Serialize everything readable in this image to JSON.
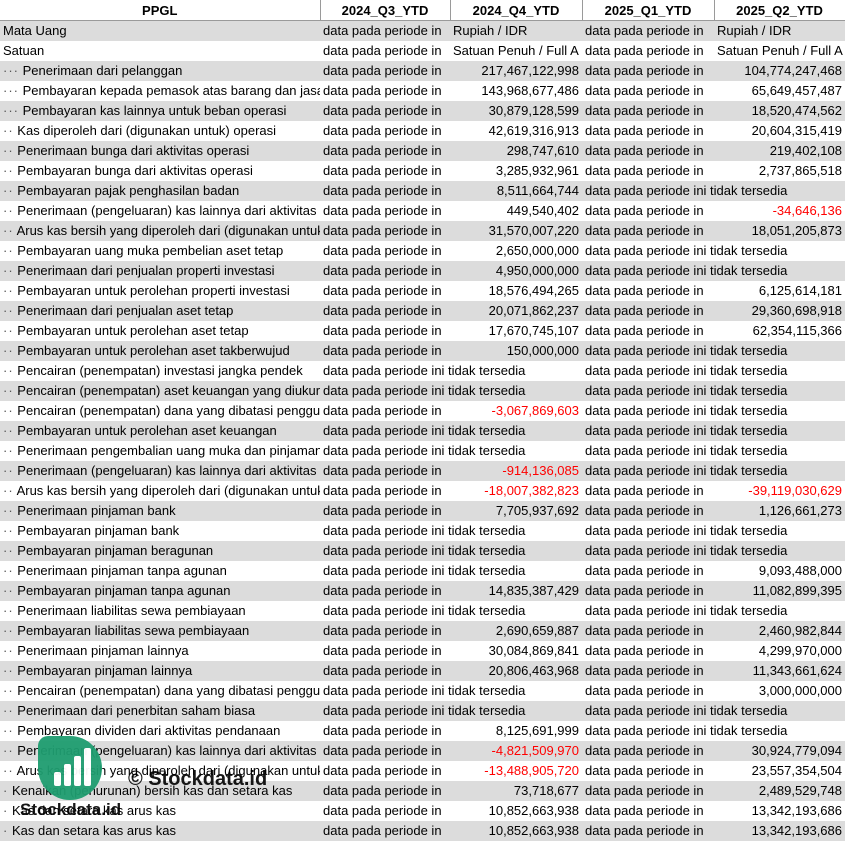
{
  "header": [
    "PPGL",
    "2024_Q3_YTD",
    "2024_Q4_YTD",
    "2025_Q1_YTD",
    "2025_Q2_YTD"
  ],
  "rows": [
    {
      "label": "Mata Uang",
      "dots": "",
      "cells": [
        {
          "v": "data pada periode in",
          "a": "l"
        },
        {
          "v": "Rupiah / IDR",
          "a": "l"
        },
        {
          "v": "data pada periode in",
          "a": "l"
        },
        {
          "v": "Rupiah / IDR",
          "a": "l"
        }
      ]
    },
    {
      "label": "Satuan",
      "dots": "",
      "cells": [
        {
          "v": "data pada periode in",
          "a": "l"
        },
        {
          "v": "Satuan Penuh / Full A",
          "a": "l"
        },
        {
          "v": "data pada periode in",
          "a": "l"
        },
        {
          "v": "Satuan Penuh / Full A",
          "a": "l"
        }
      ]
    },
    {
      "label": "Penerimaan dari pelanggan",
      "dots": "···",
      "cells": [
        {
          "v": "data pada periode in",
          "a": "l"
        },
        {
          "v": "217,467,122,998",
          "a": "r"
        },
        {
          "v": "data pada periode in",
          "a": "l"
        },
        {
          "v": "104,774,247,468",
          "a": "r"
        }
      ]
    },
    {
      "label": "Pembayaran kepada pemasok atas barang dan jasa",
      "dots": "···",
      "cells": [
        {
          "v": "data pada periode in",
          "a": "l"
        },
        {
          "v": "143,968,677,486",
          "a": "r"
        },
        {
          "v": "data pada periode in",
          "a": "l"
        },
        {
          "v": "65,649,457,487",
          "a": "r"
        }
      ]
    },
    {
      "label": "Pembayaran kas lainnya untuk beban operasi",
      "dots": "···",
      "cells": [
        {
          "v": "data pada periode in",
          "a": "l"
        },
        {
          "v": "30,879,128,599",
          "a": "r"
        },
        {
          "v": "data pada periode in",
          "a": "l"
        },
        {
          "v": "18,520,474,562",
          "a": "r"
        }
      ]
    },
    {
      "label": "Kas diperoleh dari (digunakan untuk) operasi",
      "dots": "··",
      "cells": [
        {
          "v": "data pada periode in",
          "a": "l"
        },
        {
          "v": "42,619,316,913",
          "a": "r"
        },
        {
          "v": "data pada periode in",
          "a": "l"
        },
        {
          "v": "20,604,315,419",
          "a": "r"
        }
      ]
    },
    {
      "label": "Penerimaan bunga dari aktivitas operasi",
      "dots": "··",
      "cells": [
        {
          "v": "data pada periode in",
          "a": "l"
        },
        {
          "v": "298,747,610",
          "a": "r"
        },
        {
          "v": "data pada periode in",
          "a": "l"
        },
        {
          "v": "219,402,108",
          "a": "r"
        }
      ]
    },
    {
      "label": "Pembayaran bunga dari aktivitas operasi",
      "dots": "··",
      "cells": [
        {
          "v": "data pada periode in",
          "a": "l"
        },
        {
          "v": "3,285,932,961",
          "a": "r"
        },
        {
          "v": "data pada periode in",
          "a": "l"
        },
        {
          "v": "2,737,865,518",
          "a": "r"
        }
      ]
    },
    {
      "label": "Pembayaran pajak penghasilan badan",
      "dots": "··",
      "cells": [
        {
          "v": "data pada periode in",
          "a": "l"
        },
        {
          "v": "8,511,664,744",
          "a": "r"
        },
        {
          "v": "data pada periode ini tidak tersedia",
          "a": "l",
          "span": 2
        }
      ]
    },
    {
      "label": "Penerimaan (pengeluaran) kas lainnya dari aktivitas operasi",
      "dots": "··",
      "cells": [
        {
          "v": "data pada periode in",
          "a": "l"
        },
        {
          "v": "449,540,402",
          "a": "r"
        },
        {
          "v": "data pada periode in",
          "a": "l"
        },
        {
          "v": "-34,646,136",
          "a": "r",
          "neg": true
        }
      ]
    },
    {
      "label": "Arus kas bersih yang diperoleh dari (digunakan untuk) aktivitas operasi",
      "dots": "··",
      "cells": [
        {
          "v": "data pada periode in",
          "a": "l"
        },
        {
          "v": "31,570,007,220",
          "a": "r"
        },
        {
          "v": "data pada periode in",
          "a": "l"
        },
        {
          "v": "18,051,205,873",
          "a": "r"
        }
      ]
    },
    {
      "label": "Pembayaran uang muka pembelian aset tetap",
      "dots": "··",
      "cells": [
        {
          "v": "data pada periode in",
          "a": "l"
        },
        {
          "v": "2,650,000,000",
          "a": "r"
        },
        {
          "v": "data pada periode ini tidak tersedia",
          "a": "l",
          "span": 2
        }
      ]
    },
    {
      "label": "Penerimaan dari penjualan properti investasi",
      "dots": "··",
      "cells": [
        {
          "v": "data pada periode in",
          "a": "l"
        },
        {
          "v": "4,950,000,000",
          "a": "r"
        },
        {
          "v": "data pada periode ini tidak tersedia",
          "a": "l",
          "span": 2
        }
      ]
    },
    {
      "label": "Pembayaran untuk perolehan properti investasi",
      "dots": "··",
      "cells": [
        {
          "v": "data pada periode in",
          "a": "l"
        },
        {
          "v": "18,576,494,265",
          "a": "r"
        },
        {
          "v": "data pada periode in",
          "a": "l"
        },
        {
          "v": "6,125,614,181",
          "a": "r"
        }
      ]
    },
    {
      "label": "Penerimaan dari penjualan aset tetap",
      "dots": "··",
      "cells": [
        {
          "v": "data pada periode in",
          "a": "l"
        },
        {
          "v": "20,071,862,237",
          "a": "r"
        },
        {
          "v": "data pada periode in",
          "a": "l"
        },
        {
          "v": "29,360,698,918",
          "a": "r"
        }
      ]
    },
    {
      "label": "Pembayaran untuk perolehan aset tetap",
      "dots": "··",
      "cells": [
        {
          "v": "data pada periode in",
          "a": "l"
        },
        {
          "v": "17,670,745,107",
          "a": "r"
        },
        {
          "v": "data pada periode in",
          "a": "l"
        },
        {
          "v": "62,354,115,366",
          "a": "r"
        }
      ]
    },
    {
      "label": "Pembayaran untuk perolehan aset takberwujud",
      "dots": "··",
      "cells": [
        {
          "v": "data pada periode in",
          "a": "l"
        },
        {
          "v": "150,000,000",
          "a": "r"
        },
        {
          "v": "data pada periode ini tidak tersedia",
          "a": "l",
          "span": 2
        }
      ]
    },
    {
      "label": "Pencairan (penempatan) investasi jangka pendek",
      "dots": "··",
      "cells": [
        {
          "v": "data pada periode ini tidak tersedia",
          "a": "l",
          "span": 2
        },
        {
          "v": "data pada periode ini tidak tersedia",
          "a": "l",
          "span": 2
        }
      ]
    },
    {
      "label": "Pencairan (penempatan) aset keuangan yang diukur",
      "dots": "··",
      "cells": [
        {
          "v": "data pada periode ini tidak tersedia",
          "a": "l",
          "span": 2
        },
        {
          "v": "data pada periode ini tidak tersedia",
          "a": "l",
          "span": 2
        }
      ]
    },
    {
      "label": "Pencairan (penempatan) dana yang dibatasi penggunaannya",
      "dots": "··",
      "cells": [
        {
          "v": "data pada periode in",
          "a": "l"
        },
        {
          "v": "-3,067,869,603",
          "a": "r",
          "neg": true
        },
        {
          "v": "data pada periode ini tidak tersedia",
          "a": "l",
          "span": 2
        }
      ]
    },
    {
      "label": "Pembayaran untuk perolehan aset keuangan",
      "dots": "··",
      "cells": [
        {
          "v": "data pada periode ini tidak tersedia",
          "a": "l",
          "span": 2
        },
        {
          "v": "data pada periode ini tidak tersedia",
          "a": "l",
          "span": 2
        }
      ]
    },
    {
      "label": "Penerimaan pengembalian uang muka dan pinjaman",
      "dots": "··",
      "cells": [
        {
          "v": "data pada periode ini tidak tersedia",
          "a": "l",
          "span": 2
        },
        {
          "v": "data pada periode ini tidak tersedia",
          "a": "l",
          "span": 2
        }
      ]
    },
    {
      "label": "Penerimaan (pengeluaran) kas lainnya dari aktivitas investasi",
      "dots": "··",
      "cells": [
        {
          "v": "data pada periode in",
          "a": "l"
        },
        {
          "v": "-914,136,085",
          "a": "r",
          "neg": true
        },
        {
          "v": "data pada periode ini tidak tersedia",
          "a": "l",
          "span": 2
        }
      ]
    },
    {
      "label": "Arus kas bersih yang diperoleh dari (digunakan untuk) aktivitas investasi",
      "dots": "··",
      "cells": [
        {
          "v": "data pada periode in",
          "a": "l"
        },
        {
          "v": "-18,007,382,823",
          "a": "r",
          "neg": true
        },
        {
          "v": "data pada periode in",
          "a": "l"
        },
        {
          "v": "-39,119,030,629",
          "a": "r",
          "neg": true
        }
      ]
    },
    {
      "label": "Penerimaan pinjaman bank",
      "dots": "··",
      "cells": [
        {
          "v": "data pada periode in",
          "a": "l"
        },
        {
          "v": "7,705,937,692",
          "a": "r"
        },
        {
          "v": "data pada periode in",
          "a": "l"
        },
        {
          "v": "1,126,661,273",
          "a": "r"
        }
      ]
    },
    {
      "label": "Pembayaran pinjaman bank",
      "dots": "··",
      "cells": [
        {
          "v": "data pada periode ini tidak tersedia",
          "a": "l",
          "span": 2
        },
        {
          "v": "data pada periode ini tidak tersedia",
          "a": "l",
          "span": 2
        }
      ]
    },
    {
      "label": "Pembayaran pinjaman beragunan",
      "dots": "··",
      "cells": [
        {
          "v": "data pada periode ini tidak tersedia",
          "a": "l",
          "span": 2
        },
        {
          "v": "data pada periode ini tidak tersedia",
          "a": "l",
          "span": 2
        }
      ]
    },
    {
      "label": "Penerimaan pinjaman tanpa agunan",
      "dots": "··",
      "cells": [
        {
          "v": "data pada periode ini tidak tersedia",
          "a": "l",
          "span": 2
        },
        {
          "v": "data pada periode in",
          "a": "l"
        },
        {
          "v": "9,093,488,000",
          "a": "r"
        }
      ]
    },
    {
      "label": "Pembayaran pinjaman tanpa agunan",
      "dots": "··",
      "cells": [
        {
          "v": "data pada periode in",
          "a": "l"
        },
        {
          "v": "14,835,387,429",
          "a": "r"
        },
        {
          "v": "data pada periode in",
          "a": "l"
        },
        {
          "v": "11,082,899,395",
          "a": "r"
        }
      ]
    },
    {
      "label": "Penerimaan liabilitas sewa pembiayaan",
      "dots": "··",
      "cells": [
        {
          "v": "data pada periode ini tidak tersedia",
          "a": "l",
          "span": 2
        },
        {
          "v": "data pada periode ini tidak tersedia",
          "a": "l",
          "span": 2
        }
      ]
    },
    {
      "label": "Pembayaran liabilitas sewa pembiayaan",
      "dots": "··",
      "cells": [
        {
          "v": "data pada periode in",
          "a": "l"
        },
        {
          "v": "2,690,659,887",
          "a": "r"
        },
        {
          "v": "data pada periode in",
          "a": "l"
        },
        {
          "v": "2,460,982,844",
          "a": "r"
        }
      ]
    },
    {
      "label": "Penerimaan pinjaman lainnya",
      "dots": "··",
      "cells": [
        {
          "v": "data pada periode in",
          "a": "l"
        },
        {
          "v": "30,084,869,841",
          "a": "r"
        },
        {
          "v": "data pada periode in",
          "a": "l"
        },
        {
          "v": "4,299,970,000",
          "a": "r"
        }
      ]
    },
    {
      "label": "Pembayaran pinjaman lainnya",
      "dots": "··",
      "cells": [
        {
          "v": "data pada periode in",
          "a": "l"
        },
        {
          "v": "20,806,463,968",
          "a": "r"
        },
        {
          "v": "data pada periode in",
          "a": "l"
        },
        {
          "v": "11,343,661,624",
          "a": "r"
        }
      ]
    },
    {
      "label": "Pencairan (penempatan) dana yang dibatasi penggunaannya",
      "dots": "··",
      "cells": [
        {
          "v": "data pada periode ini tidak tersedia",
          "a": "l",
          "span": 2
        },
        {
          "v": "data pada periode in",
          "a": "l"
        },
        {
          "v": "3,000,000,000",
          "a": "r"
        }
      ]
    },
    {
      "label": "Penerimaan dari penerbitan saham biasa",
      "dots": "··",
      "cells": [
        {
          "v": "data pada periode ini tidak tersedia",
          "a": "l",
          "span": 2
        },
        {
          "v": "data pada periode ini tidak tersedia",
          "a": "l",
          "span": 2
        }
      ]
    },
    {
      "label": "Pembayaran dividen dari aktivitas pendanaan",
      "dots": "··",
      "cells": [
        {
          "v": "data pada periode in",
          "a": "l"
        },
        {
          "v": "8,125,691,999",
          "a": "r"
        },
        {
          "v": "data pada periode ini tidak tersedia",
          "a": "l",
          "span": 2
        }
      ]
    },
    {
      "label": "Penerimaan (pengeluaran) kas lainnya dari aktivitas pendanaan",
      "dots": "··",
      "cells": [
        {
          "v": "data pada periode in",
          "a": "l"
        },
        {
          "v": "-4,821,509,970",
          "a": "r",
          "neg": true
        },
        {
          "v": "data pada periode in",
          "a": "l"
        },
        {
          "v": "30,924,779,094",
          "a": "r"
        }
      ]
    },
    {
      "label": "Arus kas bersih yang diperoleh dari (digunakan untuk) aktivitas pendanaan",
      "dots": "··",
      "cells": [
        {
          "v": "data pada periode in",
          "a": "l"
        },
        {
          "v": "-13,488,905,720",
          "a": "r",
          "neg": true
        },
        {
          "v": "data pada periode in",
          "a": "l"
        },
        {
          "v": "23,557,354,504",
          "a": "r"
        }
      ]
    },
    {
      "label": "Kenaikan (penurunan) bersih kas dan setara kas",
      "dots": "·",
      "cells": [
        {
          "v": "data pada periode in",
          "a": "l"
        },
        {
          "v": "73,718,677",
          "a": "r"
        },
        {
          "v": "data pada periode in",
          "a": "l"
        },
        {
          "v": "2,489,529,748",
          "a": "r"
        }
      ]
    },
    {
      "label": "Kas dan setara kas arus kas",
      "dots": "·",
      "cells": [
        {
          "v": "data pada periode in",
          "a": "l"
        },
        {
          "v": "10,852,663,938",
          "a": "r"
        },
        {
          "v": "data pada periode in",
          "a": "l"
        },
        {
          "v": "13,342,193,686",
          "a": "r"
        }
      ]
    },
    {
      "label": "Kas dan setara kas arus kas",
      "dots": "·",
      "cells": [
        {
          "v": "data pada periode in",
          "a": "l"
        },
        {
          "v": "10,852,663,938",
          "a": "r"
        },
        {
          "v": "data pada periode in",
          "a": "l"
        },
        {
          "v": "13,342,193,686",
          "a": "r"
        }
      ]
    }
  ],
  "watermark": {
    "text_big": "© Stockdata.id",
    "text_small": "Stockdata.id"
  },
  "colors": {
    "stripe": "#dcdcdc",
    "negative": "#ff0000",
    "logo": "#1f9d70"
  }
}
